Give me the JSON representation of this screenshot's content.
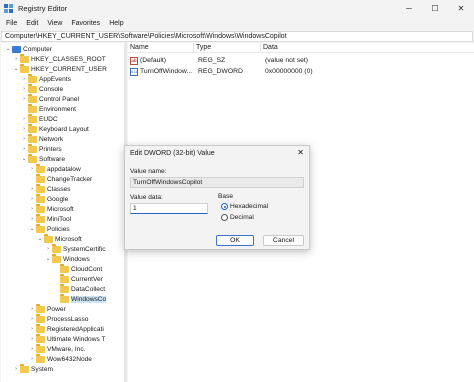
{
  "window": {
    "title": "Registry Editor",
    "minimize": "─",
    "maximize": "☐",
    "close": "✕"
  },
  "menu": [
    "File",
    "Edit",
    "View",
    "Favorites",
    "Help"
  ],
  "address": "Computer\\HKEY_CURRENT_USER\\Software\\Policies\\Microsoft\\Windows\\WindowsCopilot",
  "tree": [
    {
      "label": "Computer",
      "expander": "⌄",
      "icon": "pc"
    },
    {
      "label": "HKEY_CLASSES_ROOT",
      "expander": "›",
      "icon": "folder"
    },
    {
      "label": "HKEY_CURRENT_USER",
      "expander": "⌄",
      "icon": "folder"
    },
    {
      "label": "AppEvents",
      "expander": "›",
      "icon": "folder"
    },
    {
      "label": "Console",
      "expander": "›",
      "icon": "folder"
    },
    {
      "label": "Control Panel",
      "expander": "›",
      "icon": "folder"
    },
    {
      "label": "Environment",
      "expander": "",
      "icon": "folder"
    },
    {
      "label": "EUDC",
      "expander": "›",
      "icon": "folder"
    },
    {
      "label": "Keyboard Layout",
      "expander": "›",
      "icon": "folder"
    },
    {
      "label": "Network",
      "expander": "›",
      "icon": "folder"
    },
    {
      "label": "Printers",
      "expander": "›",
      "icon": "folder"
    },
    {
      "label": "Software",
      "expander": "⌄",
      "icon": "folder"
    },
    {
      "label": "appdatalow",
      "expander": "›",
      "icon": "folder"
    },
    {
      "label": "ChangeTracker",
      "expander": "",
      "icon": "folder"
    },
    {
      "label": "Classes",
      "expander": "›",
      "icon": "folder"
    },
    {
      "label": "Google",
      "expander": "›",
      "icon": "folder"
    },
    {
      "label": "Microsoft",
      "expander": "›",
      "icon": "folder"
    },
    {
      "label": "MiniTool",
      "expander": "›",
      "icon": "folder"
    },
    {
      "label": "Policies",
      "expander": "⌄",
      "icon": "folder"
    },
    {
      "label": "Microsoft",
      "expander": "⌄",
      "icon": "folder"
    },
    {
      "label": "SystemCertific",
      "expander": "›",
      "icon": "folder"
    },
    {
      "label": "Windows",
      "expander": "⌄",
      "icon": "folder"
    },
    {
      "label": "CloudCont",
      "expander": "",
      "icon": "folder"
    },
    {
      "label": "CurrentVer",
      "expander": "",
      "icon": "folder"
    },
    {
      "label": "DataCollect",
      "expander": "",
      "icon": "folder"
    },
    {
      "label": "WindowsCo",
      "expander": "",
      "icon": "folder"
    },
    {
      "label": "Power",
      "expander": "›",
      "icon": "folder"
    },
    {
      "label": "ProcessLasso",
      "expander": "›",
      "icon": "folder"
    },
    {
      "label": "RegisteredApplicati",
      "expander": "›",
      "icon": "folder"
    },
    {
      "label": "Ultimate Windows T",
      "expander": "›",
      "icon": "folder"
    },
    {
      "label": "VMware, Inc.",
      "expander": "›",
      "icon": "folder"
    },
    {
      "label": "Wow6432Node",
      "expander": "›",
      "icon": "folder"
    },
    {
      "label": "System",
      "expander": "›",
      "icon": "folder"
    }
  ],
  "list": {
    "headers": [
      "Name",
      "Type",
      "Data"
    ],
    "rows": [
      {
        "icon": "ab",
        "icon_text": "ab",
        "name": "(Default)",
        "type": "REG_SZ",
        "data": "(value not set)"
      },
      {
        "icon": "bin",
        "icon_text": "011",
        "name": "TurnOffWindow...",
        "type": "REG_DWORD",
        "data": "0x00000000 (0)"
      }
    ]
  },
  "dialog": {
    "title": "Edit DWORD (32-bit) Value",
    "close": "✕",
    "value_name_label": "Value name:",
    "value_name": "TurnOffWindowsCopilot",
    "value_data_label": "Value data:",
    "value_data": "1",
    "base_label": "Base",
    "hex_label": "Hexadecimal",
    "dec_label": "Decimal",
    "ok": "OK",
    "cancel": "Cancel"
  }
}
